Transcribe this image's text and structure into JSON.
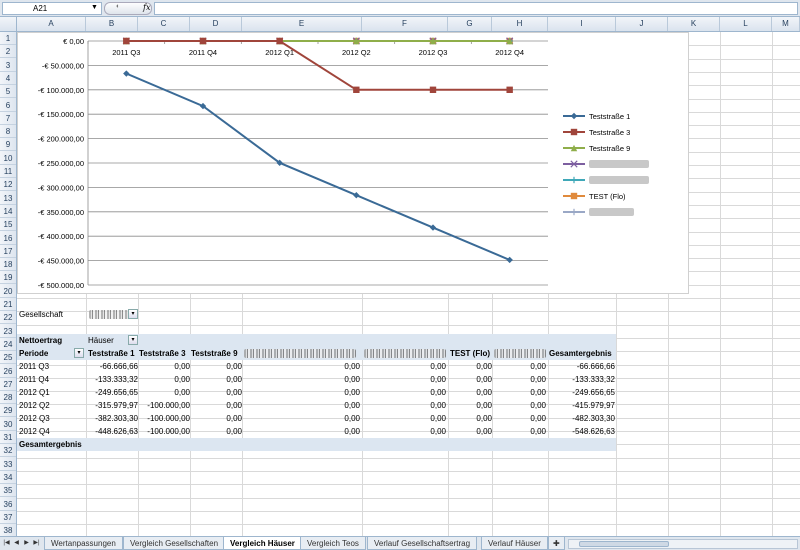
{
  "formula_bar": {
    "name_box": "A21",
    "fx": "fx"
  },
  "columns": [
    "A",
    "B",
    "C",
    "D",
    "E",
    "F",
    "G",
    "H",
    "I",
    "J",
    "K",
    "L",
    "M"
  ],
  "rows": [
    "1",
    "2",
    "3",
    "4",
    "5",
    "6",
    "7",
    "8",
    "9",
    "10",
    "11",
    "12",
    "13",
    "14",
    "15",
    "16",
    "17",
    "18",
    "19",
    "20",
    "21",
    "22",
    "23",
    "24",
    "25",
    "26",
    "27",
    "28",
    "29",
    "30",
    "31",
    "32",
    "33",
    "34",
    "35",
    "36",
    "37",
    "38"
  ],
  "chart_data": {
    "type": "line",
    "categories": [
      "2011 Q3",
      "2011 Q4",
      "2012 Q1",
      "2012 Q2",
      "2012 Q3",
      "2012 Q4"
    ],
    "y_tick_labels": [
      "€ 0,00",
      "-€ 50.000,00",
      "-€ 100.000,00",
      "-€ 150.000,00",
      "-€ 200.000,00",
      "-€ 250.000,00",
      "-€ 300.000,00",
      "-€ 350.000,00",
      "-€ 400.000,00",
      "-€ 450.000,00",
      "-€ 500.000,00"
    ],
    "ylim": [
      -500000,
      0
    ],
    "grid": true,
    "legend_position": "right",
    "series": [
      {
        "name": "Teststraße 1",
        "color": "#3a6a96",
        "marker": "diamond",
        "values": [
          -66666.66,
          -133333.32,
          -249656.65,
          -315979.97,
          -382303.3,
          -448626.63
        ]
      },
      {
        "name": "Teststraße 3",
        "color": "#a0453b",
        "marker": "square",
        "values": [
          0,
          0,
          0,
          -100000,
          -100000,
          -100000
        ]
      },
      {
        "name": "Teststraße 9",
        "color": "#8fae4a",
        "marker": "triangle",
        "values": [
          0,
          0,
          0,
          0,
          0,
          0
        ]
      },
      {
        "name": "",
        "color": "#7d5fa0",
        "marker": "x",
        "values": [
          0,
          0,
          0,
          0,
          0,
          0
        ]
      },
      {
        "name": "",
        "color": "#3fa8b8",
        "marker": "star",
        "values": [
          0,
          0,
          0,
          0,
          0,
          0
        ]
      },
      {
        "name": "TEST (Flo)",
        "color": "#e08a3c",
        "marker": "circle",
        "values": [
          0,
          0,
          0,
          0,
          0,
          0
        ]
      },
      {
        "name": "",
        "color": "#9aa8c6",
        "marker": "plus",
        "values": [
          0,
          0,
          0,
          0,
          0,
          0
        ]
      }
    ]
  },
  "pivot": {
    "filter_label": "Gesellschaft",
    "data_field": "Nettoertrag",
    "column_field": "Häuser",
    "row_field": "Periode",
    "headers": [
      "Teststraße 1",
      "Teststraße 3",
      "Teststraße 9",
      "",
      "",
      "TEST (Flo)",
      "",
      "Gesamtergebnis"
    ],
    "rows": [
      {
        "label": "2011 Q3",
        "values": [
          "-66.666,66",
          "0,00",
          "0,00",
          "0,00",
          "0,00",
          "0,00",
          "0,00",
          "-66.666,66"
        ]
      },
      {
        "label": "2011 Q4",
        "values": [
          "-133.333,32",
          "0,00",
          "0,00",
          "0,00",
          "0,00",
          "0,00",
          "0,00",
          "-133.333,32"
        ]
      },
      {
        "label": "2012 Q1",
        "values": [
          "-249.656,65",
          "0,00",
          "0,00",
          "0,00",
          "0,00",
          "0,00",
          "0,00",
          "-249.656,65"
        ]
      },
      {
        "label": "2012 Q2",
        "values": [
          "-315.979,97",
          "-100.000,00",
          "0,00",
          "0,00",
          "0,00",
          "0,00",
          "0,00",
          "-415.979,97"
        ]
      },
      {
        "label": "2012 Q3",
        "values": [
          "-382.303,30",
          "-100.000,00",
          "0,00",
          "0,00",
          "0,00",
          "0,00",
          "0,00",
          "-482.303,30"
        ]
      },
      {
        "label": "2012 Q4",
        "values": [
          "-448.626,63",
          "-100.000,00",
          "0,00",
          "0,00",
          "0,00",
          "0,00",
          "0,00",
          "-548.626,63"
        ]
      }
    ],
    "grand_total_label": "Gesamtergebnis"
  },
  "sheet_tabs": {
    "tabs": [
      "Wertanpassungen",
      "Vergleich Gesellschaften",
      "Vergleich Häuser",
      "Vergleich Teos",
      "Verlauf Gesellschaftsertrag",
      "Verlauf Häuser"
    ],
    "active": "Vergleich Häuser"
  }
}
